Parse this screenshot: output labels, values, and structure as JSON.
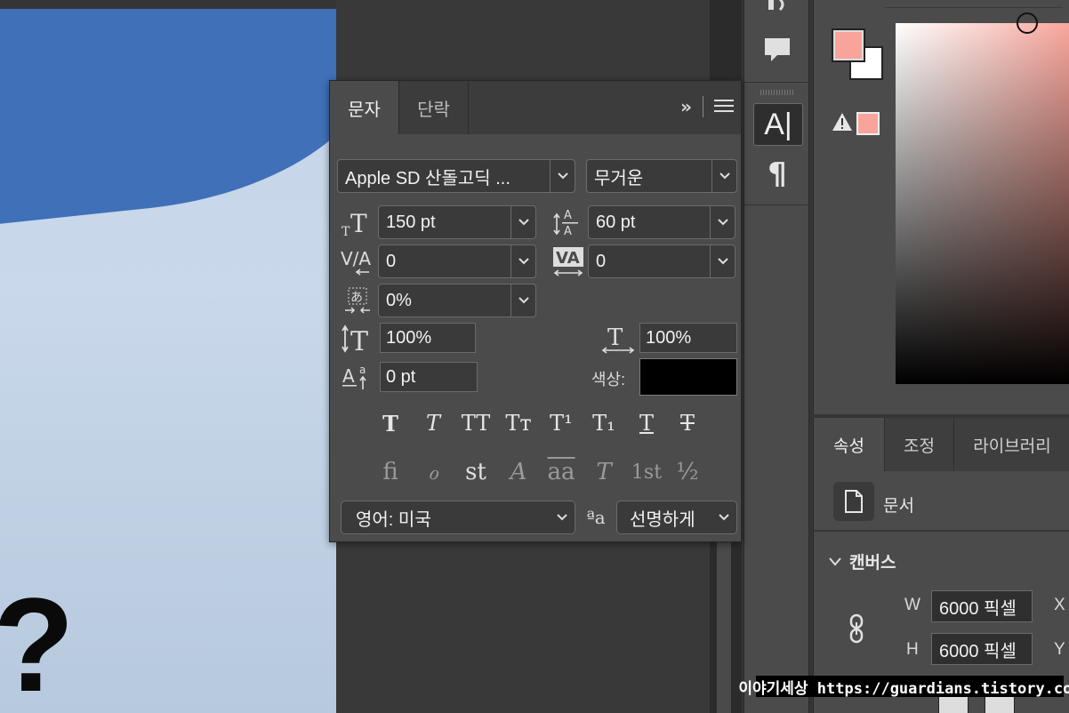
{
  "character_panel": {
    "tabs": [
      "문자",
      "단락"
    ],
    "font_family": "Apple SD 산돌고딕 ...",
    "font_style": "무거운",
    "font_size": "150 pt",
    "leading": "60 pt",
    "kerning": "0",
    "tracking": "0",
    "tsume": "0%",
    "vertical_scale": "100%",
    "horizontal_scale": "100%",
    "baseline_shift": "0 pt",
    "color_label": "색상:",
    "color_value": "#000000",
    "language": "영어: 미국",
    "antialias": "선명하게",
    "antialias_icon_text": "ªa",
    "style_buttons": [
      "T",
      "T",
      "TT",
      "Tт",
      "T¹",
      "T₁",
      "T",
      "T"
    ],
    "opentype_buttons": [
      "ﬁ",
      "ℴ",
      "st",
      "A",
      "aa",
      "T",
      "1st",
      "½"
    ]
  },
  "tool_strip": {
    "items": [
      "notes-icon",
      "comment-icon",
      "character-panel-icon",
      "paragraph-icon"
    ],
    "active_glyph": "A|",
    "paragraph_glyph": "¶"
  },
  "color_panel": {
    "foreground": "#f9a49a",
    "background": "#ffffff",
    "warning_icon": "gamut-warning-icon"
  },
  "properties_panel": {
    "tabs": [
      "속성",
      "조정",
      "라이브러리"
    ],
    "doc_label": "문서",
    "section": "캔버스",
    "w_label": "W",
    "h_label": "H",
    "w_value": "6000 픽셀",
    "h_value": "6000 픽셀",
    "x_label": "X",
    "y_label": "Y"
  },
  "canvas": {
    "glyph": "?"
  },
  "watermark": "이야기세상 https://guardians.tistory.com"
}
